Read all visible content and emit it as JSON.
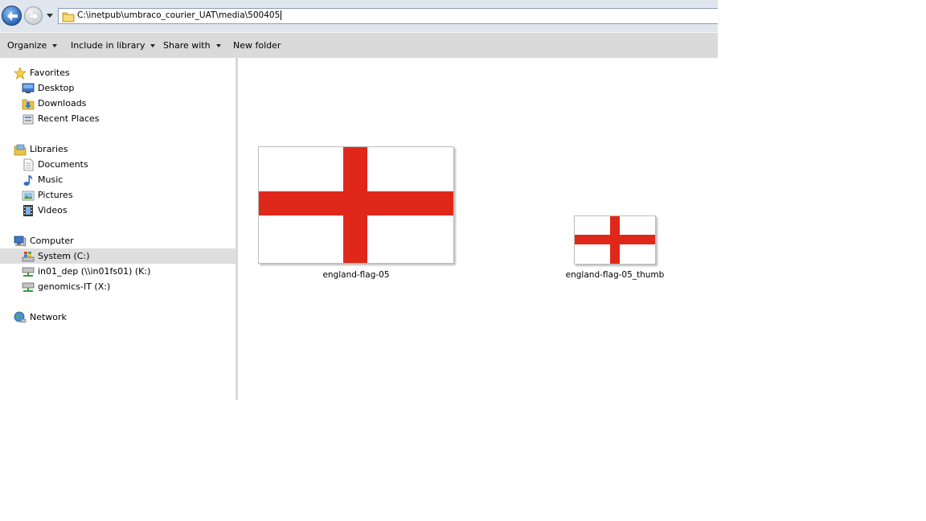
{
  "address_bar": {
    "path": "C:\\inetpub\\umbraco_courier_UAT\\media\\500405"
  },
  "toolbar": {
    "organize": "Organize",
    "include_in_library": "Include in library",
    "share_with": "Share with",
    "new_folder": "New folder"
  },
  "nav": {
    "favorites": {
      "label": "Favorites",
      "items": [
        "Desktop",
        "Downloads",
        "Recent Places"
      ]
    },
    "libraries": {
      "label": "Libraries",
      "items": [
        "Documents",
        "Music",
        "Pictures",
        "Videos"
      ]
    },
    "computer": {
      "label": "Computer",
      "items": [
        "System (C:)",
        "in01_dep (\\\\in01fs01) (K:)",
        "genomics-IT (X:)"
      ]
    },
    "network": {
      "label": "Network"
    },
    "selected": "System (C:)"
  },
  "files": [
    {
      "name": "england-flag-05",
      "icon": "england-flag-image"
    },
    {
      "name": "england-flag-05_thumb",
      "icon": "england-flag-image"
    }
  ],
  "colors": {
    "flag_red": "#e0281a",
    "selection": "#dedede",
    "toolbar": "#dadada"
  }
}
